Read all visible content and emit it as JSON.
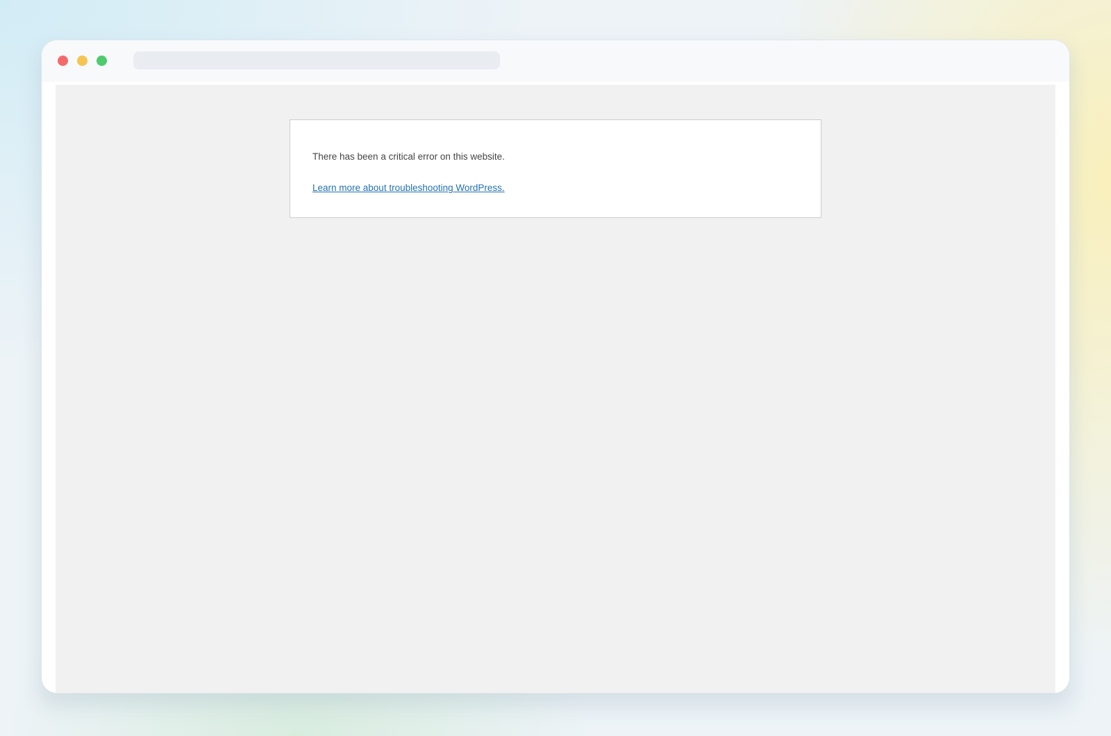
{
  "browser": {
    "traffic_lights": [
      {
        "name": "close",
        "color": "#f46a6a"
      },
      {
        "name": "minimize",
        "color": "#f5c452"
      },
      {
        "name": "maximize",
        "color": "#4ecb6e"
      }
    ],
    "address_bar_text": ""
  },
  "page": {
    "background_color": "#f1f1f1",
    "error_message": "There has been a critical error on this website.",
    "link_text": "Learn more about troubleshooting WordPress.",
    "link_color": "#2271b1"
  }
}
